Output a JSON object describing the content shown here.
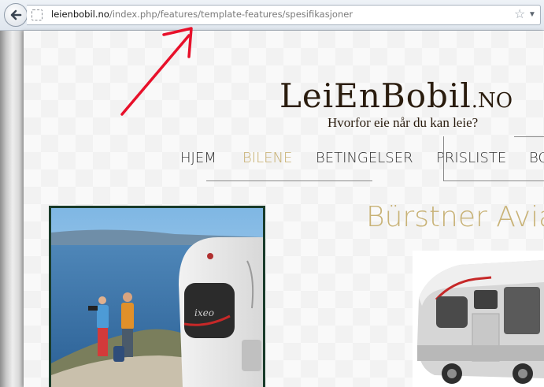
{
  "browser": {
    "url_domain": "leienbobil.no",
    "url_path": "/index.php/features/template-features/spesifikasjoner",
    "back_icon": "back-arrow-icon",
    "star_icon": "star-icon",
    "dropdown_icon": "dropdown-arrow-icon"
  },
  "site": {
    "logo_text": "LeiEnBobil",
    "logo_tld": ".NO",
    "tagline": "Hvorfor eie når du kan leie?"
  },
  "nav": {
    "items": [
      {
        "label": "HJEM",
        "active": false
      },
      {
        "label": "BILENE",
        "active": true
      },
      {
        "label": "BETINGELSER",
        "active": false
      },
      {
        "label": "PRISLISTE",
        "active": false
      },
      {
        "label": "BO",
        "active": false
      }
    ]
  },
  "main": {
    "heading": "Bürstner Avia"
  },
  "photo": {
    "badge_text": "ixeo"
  },
  "colors": {
    "accent_gold": "#c6ad6c",
    "logo_brown": "#2a1c0e",
    "annotation_red": "#e8102a"
  }
}
